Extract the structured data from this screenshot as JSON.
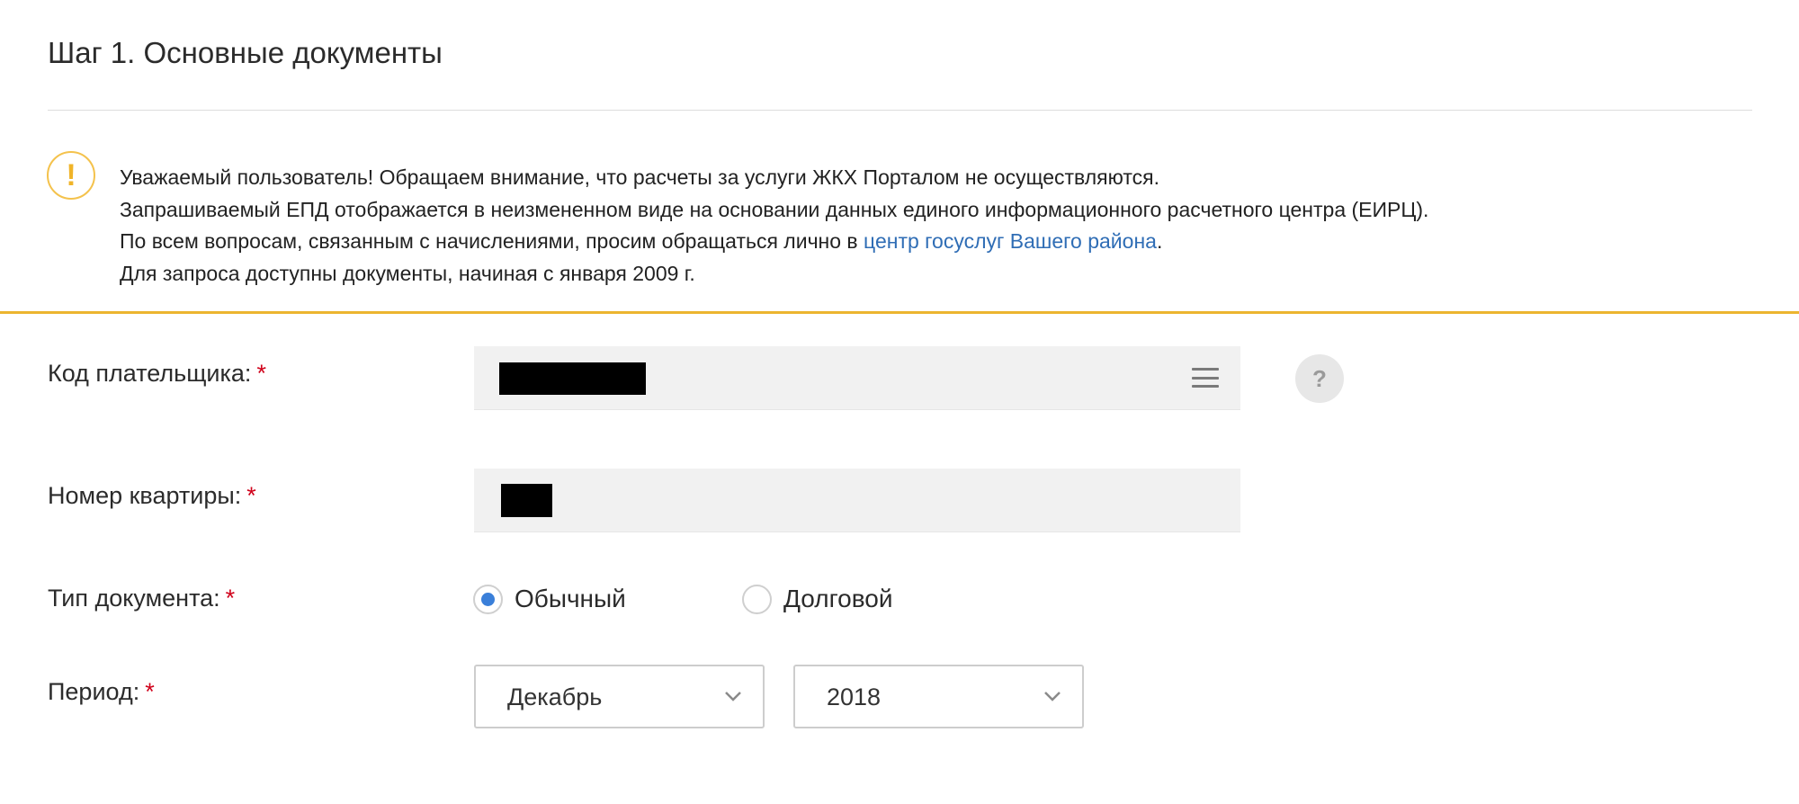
{
  "page": {
    "title": "Шаг 1. Основные документы"
  },
  "notice": {
    "icon": "warning-icon",
    "icon_glyph": "!",
    "line1": "Уважаемый пользователь! Обращаем внимание, что расчеты за услуги ЖКХ Порталом не осуществляются.",
    "line2": "Запрашиваемый ЕПД отображается в неизмененном виде на основании данных единого информационного расчетного центра (ЕИРЦ).",
    "line3_before": "По всем вопросам, связанным с начислениями, просим обращаться лично в ",
    "line3_link": "центр госуслуг Вашего района",
    "line3_after": ".",
    "line4": "Для запроса доступны документы, начиная с января 2009 г."
  },
  "form": {
    "required_mark": "*",
    "payer_code": {
      "label": "Код плательщика:",
      "value_redacted": true,
      "menu_icon": "list-menu-icon"
    },
    "help": {
      "icon": "help-icon",
      "glyph": "?"
    },
    "apartment": {
      "label": "Номер квартиры:",
      "value_redacted": true
    },
    "doc_type": {
      "label": "Тип документа:",
      "options": [
        {
          "label": "Обычный",
          "selected": true
        },
        {
          "label": "Долговой",
          "selected": false
        }
      ]
    },
    "period": {
      "label": "Период:",
      "month": "Декабрь",
      "year": "2018"
    }
  },
  "colors": {
    "accent": "#ecb52f",
    "link": "#2f6db5",
    "required": "#d0021b",
    "radio_selected": "#3a7fd9"
  }
}
